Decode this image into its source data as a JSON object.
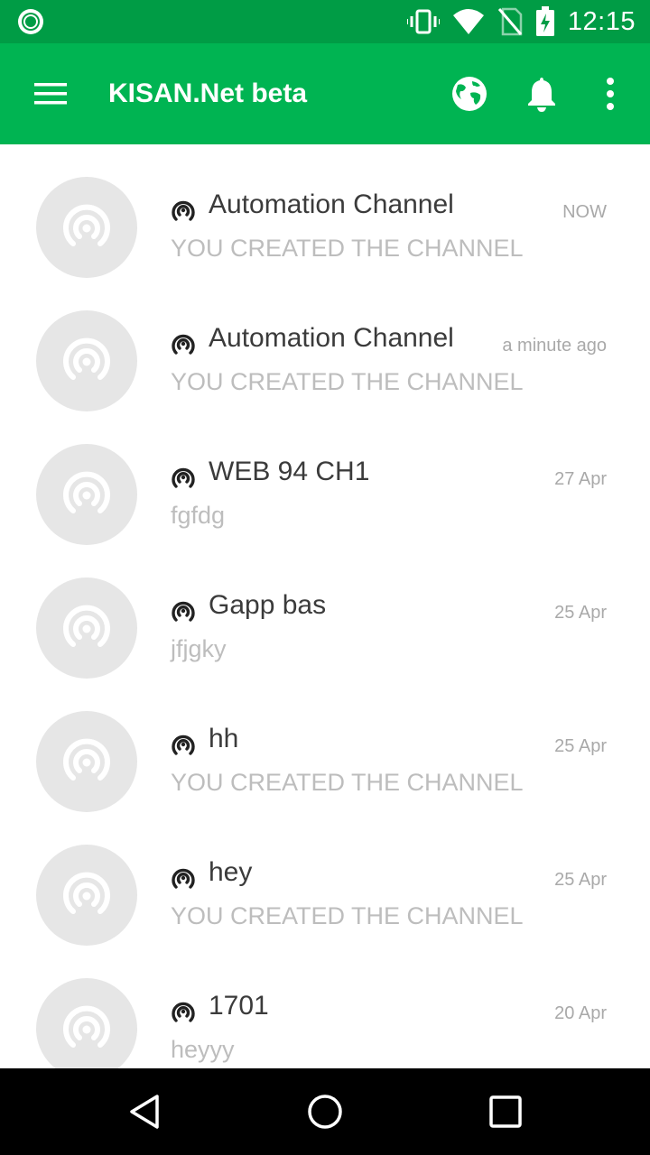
{
  "status_bar": {
    "time": "12:15",
    "icons": [
      "app-notification-icon",
      "vibrate-icon",
      "wifi-icon",
      "no-sim-icon",
      "battery-charging-icon"
    ]
  },
  "app_bar": {
    "title": "KISAN.Net beta",
    "icons": [
      "menu-icon",
      "globe-icon",
      "bell-icon",
      "more-vert-icon"
    ]
  },
  "channels": [
    {
      "name": "Automation Channel",
      "preview": "YOU CREATED THE CHANNEL",
      "time": "NOW"
    },
    {
      "name": "Automation Channel",
      "preview": "YOU CREATED THE CHANNEL",
      "time": "a minute ago"
    },
    {
      "name": "WEB 94 CH1",
      "preview": "fgfdg",
      "time": "27 Apr"
    },
    {
      "name": "Gapp bas",
      "preview": "jfjgky",
      "time": "25 Apr"
    },
    {
      "name": "hh",
      "preview": "YOU CREATED THE CHANNEL",
      "time": "25 Apr"
    },
    {
      "name": "hey",
      "preview": "YOU CREATED THE CHANNEL",
      "time": "25 Apr"
    },
    {
      "name": "1701",
      "preview": "heyyy",
      "time": "20 Apr"
    }
  ],
  "colors": {
    "status_bar": "#009c45",
    "app_bar": "#00b452",
    "avatar_bg": "#e6e6e6",
    "name_text": "#3b3b3b",
    "secondary_text": "#bdbdbd"
  },
  "nav_bar": {
    "icons": [
      "back-icon",
      "home-icon",
      "recents-icon"
    ]
  }
}
